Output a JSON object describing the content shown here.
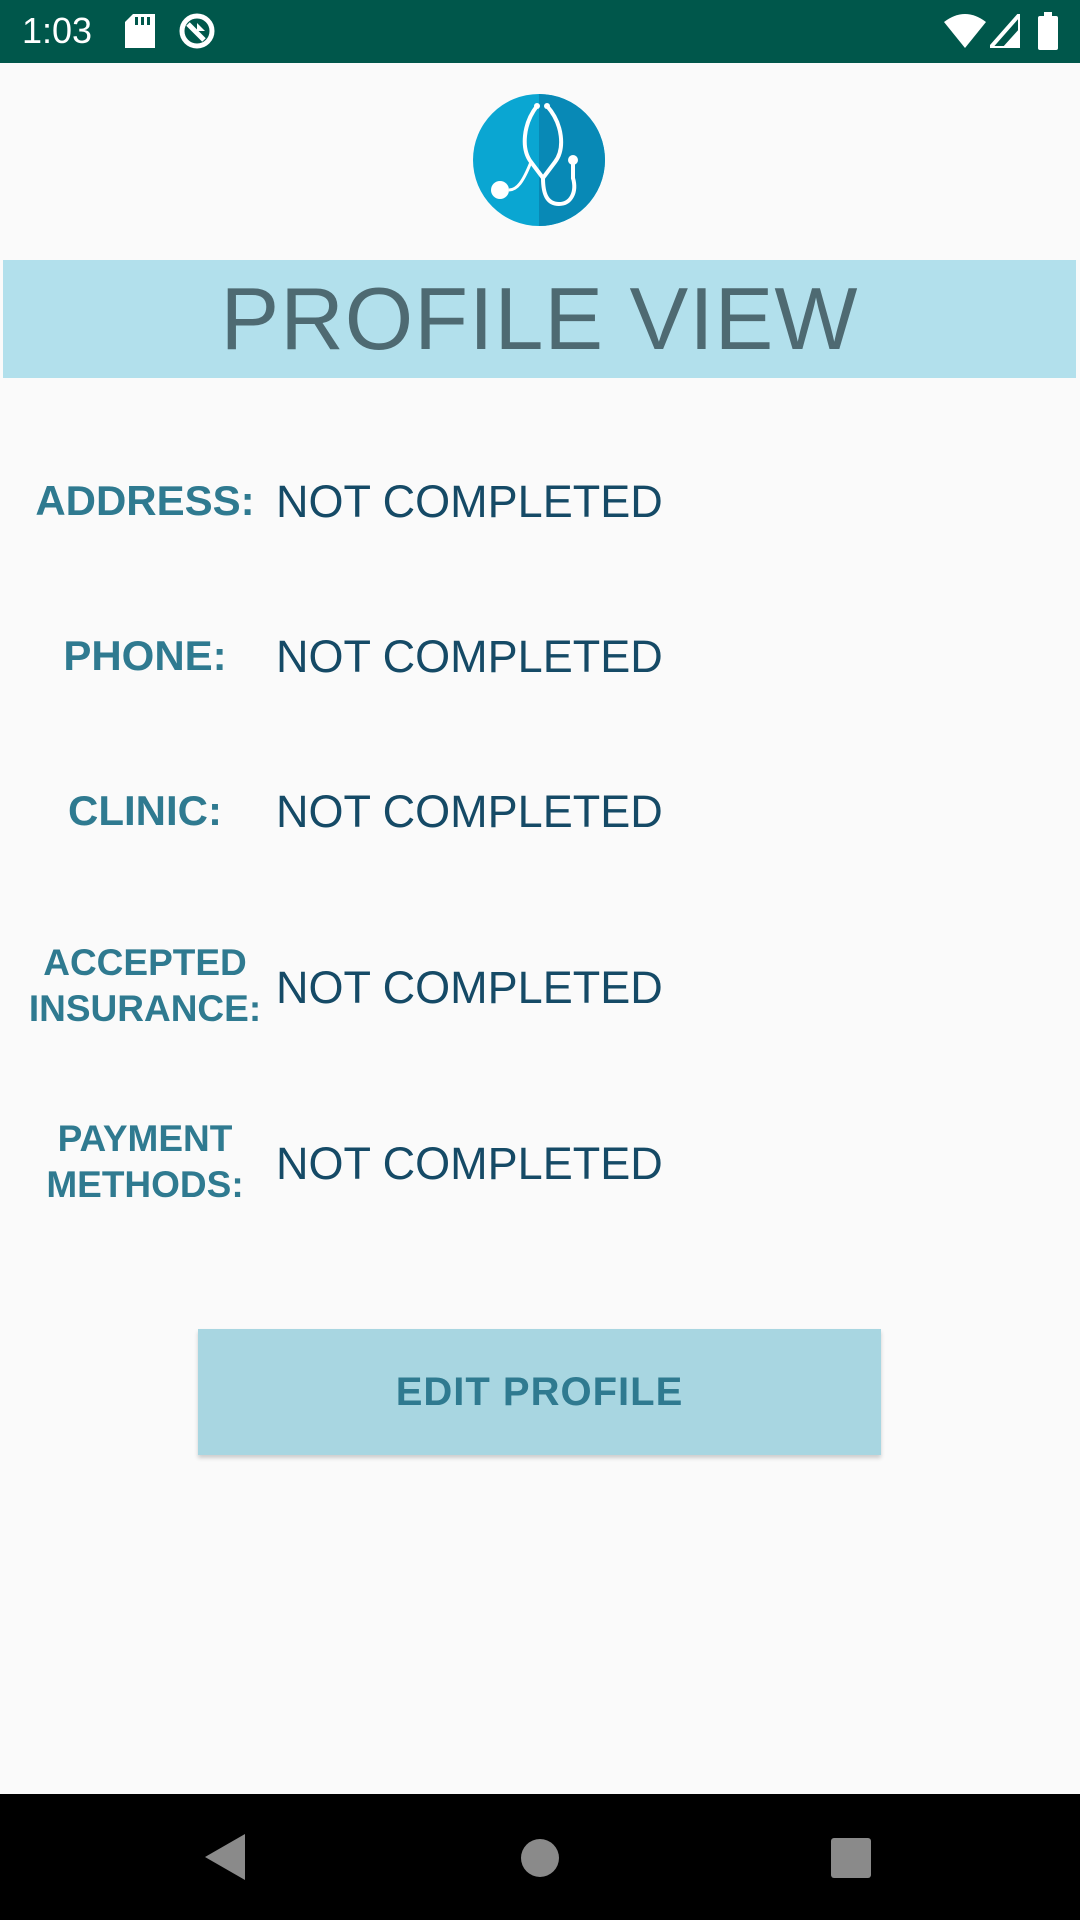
{
  "status_bar": {
    "time": "1:03",
    "bg_color": "#00574b",
    "left_icons": [
      "sd-card-icon",
      "vpn-circle-icon"
    ],
    "right_icons": [
      "wifi-icon",
      "cell-signal-icon",
      "battery-icon"
    ]
  },
  "header": {
    "logo_icon": "stethoscope-icon",
    "title": "PROFILE VIEW",
    "banner_color": "#b2e0ec"
  },
  "fields": [
    {
      "label": "ADDRESS:",
      "value": "NOT COMPLETED"
    },
    {
      "label": "PHONE:",
      "value": "NOT COMPLETED"
    },
    {
      "label": "CLINIC:",
      "value": "NOT COMPLETED"
    },
    {
      "label_lines": [
        "ACCEPTED",
        "INSURANCE:"
      ],
      "value": "NOT COMPLETED"
    },
    {
      "label_lines": [
        "PAYMENT",
        "METHODS:"
      ],
      "value": "NOT COMPLETED"
    }
  ],
  "edit_button": {
    "label": "EDIT PROFILE",
    "color": "#a8d6e1"
  },
  "nav_bar": {
    "icons": [
      "back-triangle-icon",
      "home-circle-icon",
      "recents-square-icon"
    ]
  }
}
